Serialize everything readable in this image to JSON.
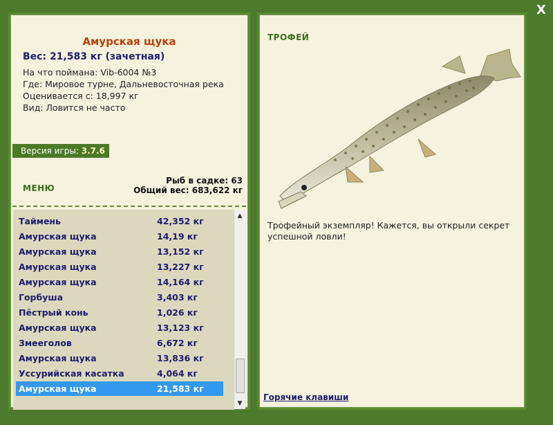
{
  "close_label": "X",
  "fish": {
    "title": "Амурская щука",
    "weight_line": "Вес: 21,583 кг (зачетная)",
    "caught_on": "На что поймана: Vib-6004 №3",
    "location": "Где: Мировое турне, Дальневосточная река",
    "valued_from": "Оценивается с: 18,997 кг",
    "kind": "Вид: Ловится не часто"
  },
  "version": {
    "label": "Версия игры:",
    "value": "3.7.6"
  },
  "menu_label": "МЕНЮ",
  "stats": {
    "count": "Рыб в садке: 63",
    "total_weight": "Общий вес: 683,622 кг"
  },
  "catch_list": [
    {
      "name": "Таймень",
      "weight": "42,352 кг"
    },
    {
      "name": "Амурская щука",
      "weight": "14,19 кг"
    },
    {
      "name": "Амурская щука",
      "weight": "13,152 кг"
    },
    {
      "name": "Амурская щука",
      "weight": "13,227 кг"
    },
    {
      "name": "Амурская щука",
      "weight": "14,164 кг"
    },
    {
      "name": "Горбуша",
      "weight": "3,403 кг"
    },
    {
      "name": "Пёстрый конь",
      "weight": "1,026 кг"
    },
    {
      "name": "Амурская щука",
      "weight": "13,123 кг"
    },
    {
      "name": "Змееголов",
      "weight": "6,672 кг"
    },
    {
      "name": "Амурская щука",
      "weight": "13,836 кг"
    },
    {
      "name": "Уссурийская касатка",
      "weight": "4,064 кг"
    },
    {
      "name": "Амурская щука",
      "weight": "21,583 кг"
    }
  ],
  "selected_index": 11,
  "trophy_label": "ТРОФЕЙ",
  "description": "Трофейный экземпляр! Кажется, вы открыли секрет успешной ловли!",
  "hotkeys_label": "Горячие клавиши",
  "colors": {
    "frame": "#4d7a2c",
    "panel": "#f5f2de",
    "title": "#b8400c",
    "selected": "#3399ee"
  }
}
